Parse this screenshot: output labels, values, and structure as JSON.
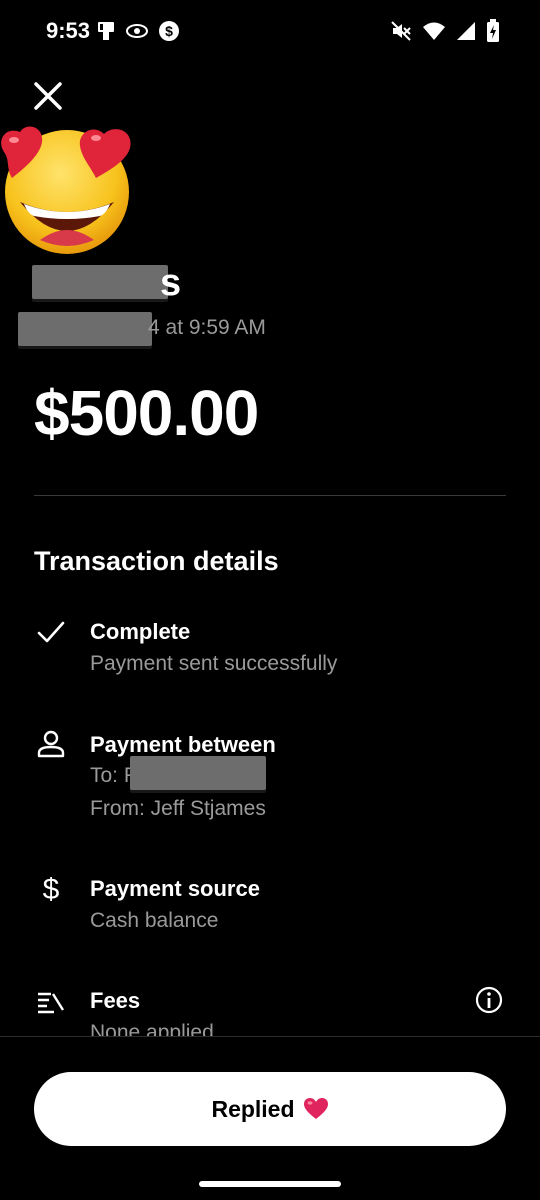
{
  "status_bar": {
    "time": "9:53",
    "left_icons": [
      "clipboard-icon",
      "eye-icon",
      "cash-app-icon"
    ],
    "right_icons": [
      "mute-icon",
      "wifi-icon",
      "signal-icon",
      "battery-charging-icon"
    ]
  },
  "header": {
    "close_icon": "close-icon",
    "emoji": "heart-eyes-emoji"
  },
  "recipient": {
    "name_visible_suffix": "s",
    "date_visible_suffix": "4 at 9:59 AM"
  },
  "amount": "$500.00",
  "details": {
    "section_title": "Transaction details",
    "status": {
      "icon": "check-icon",
      "title": "Complete",
      "subtitle": "Payment sent successfully"
    },
    "between": {
      "icon": "person-icon",
      "title": "Payment between",
      "to_prefix": "To: F",
      "from": "From: Jeff Stjames"
    },
    "source": {
      "icon": "dollar-icon",
      "title": "Payment source",
      "subtitle": "Cash balance"
    },
    "fees": {
      "icon": "fees-list-icon",
      "title": "Fees",
      "subtitle": "None applied",
      "info_icon": "info-icon"
    }
  },
  "action": {
    "label": "Replied",
    "heart": "❤️"
  },
  "colors": {
    "background": "#000000",
    "text": "#ffffff",
    "muted": "#9a9a9a",
    "button": "#ffffff",
    "heart": "#e0245e"
  }
}
